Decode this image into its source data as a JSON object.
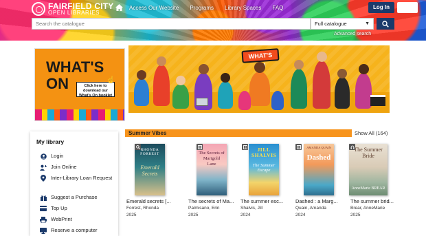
{
  "header": {
    "logo_top": "FAIRFIELD CITY",
    "logo_bottom": "OPEN LIBRARIES",
    "nav": [
      "Access Our Website",
      "Programs",
      "Library Spaces",
      "FAQ"
    ],
    "login_label": "Log In",
    "search_placeholder": "Search the catalogue",
    "scope_selected": "Full catalogue",
    "advanced_search": "Advanced search"
  },
  "promo": {
    "whats_on_line1": "WHAT'S",
    "whats_on_line2": "ON",
    "download_text": "Click here to download our What's On booklet",
    "banner_title": "WHAT'S ON"
  },
  "sidebar": {
    "heading": "My library",
    "items": [
      {
        "label": "Login",
        "icon": "user-circle-icon"
      },
      {
        "label": "Join Online",
        "icon": "user-plus-icon"
      },
      {
        "label": "Inter-Library Loan Request",
        "icon": "pin-icon"
      },
      {
        "label": "Suggest a Purchase",
        "icon": "gift-icon"
      },
      {
        "label": "Top Up",
        "icon": "card-icon"
      },
      {
        "label": "WebPrint",
        "icon": "printer-icon"
      },
      {
        "label": "Reserve a computer",
        "icon": "monitor-icon"
      }
    ]
  },
  "carousel": {
    "section_title": "Summer Vibes",
    "show_all": "Show All (164)",
    "books": [
      {
        "title": "Emerald secrets [...",
        "author": "Forrest, Rhonda",
        "year": "2025",
        "cover_title": "Emerald Secrets",
        "cover_author": "RHONDA FORREST",
        "badge": "search-icon"
      },
      {
        "title": "The secrets of Ma...",
        "author": "Palmisano, Erin",
        "year": "2025",
        "cover_title": "The Secrets of Marigold Lane",
        "cover_author": "",
        "badge": "book-icon"
      },
      {
        "title": "The summer esc...",
        "author": "Shalvis, Jill",
        "year": "2024",
        "cover_title": "The Summer Escape",
        "cover_author": "JILL SHALVIS",
        "badge": "book-icon"
      },
      {
        "title": "Dashed : a Marg...",
        "author": "Quain, Amanda",
        "year": "2024",
        "cover_title": "Dashed",
        "cover_author": "AMANDA QUAIN",
        "badge": "book-icon"
      },
      {
        "title": "The summer brid...",
        "author": "Brear, AnneMarie",
        "year": "2025",
        "cover_title": "The Summer Bride",
        "cover_author": "AnneMarie BREAR",
        "badge": "audio-icon"
      }
    ]
  }
}
